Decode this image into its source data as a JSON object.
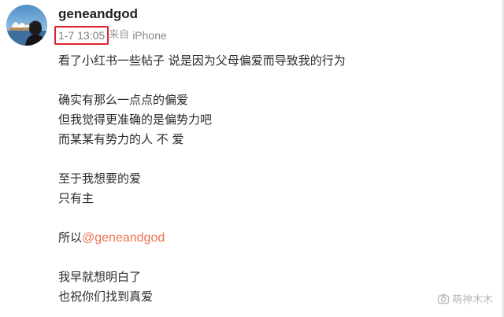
{
  "post": {
    "username": "geneandgod",
    "timestamp": "1-7 13:05",
    "source_prefix": "来自",
    "source_device": "iPhone",
    "paragraphs": {
      "p1": [
        "看了小红书一些帖子 说是因为父母偏爱而导致我的行为"
      ],
      "p2": [
        "确实有那么一点点的偏爱",
        "但我觉得更准确的是偏势力吧",
        "而某某有势力的人 不 爱"
      ],
      "p3": [
        "至于我想要的爱",
        "只有主"
      ],
      "p4_prefix": "所以",
      "p4_mention": "@geneandgod",
      "p5": [
        "我早就想明白了",
        "也祝你们找到真爱"
      ]
    }
  },
  "watermark": {
    "text": "萌神木木",
    "icon": "camera-icon"
  },
  "colors": {
    "timestamp_highlight": "#e0212a",
    "mention": "#eb7350",
    "text": "#2b2b2b",
    "meta": "#8a8a8a"
  }
}
